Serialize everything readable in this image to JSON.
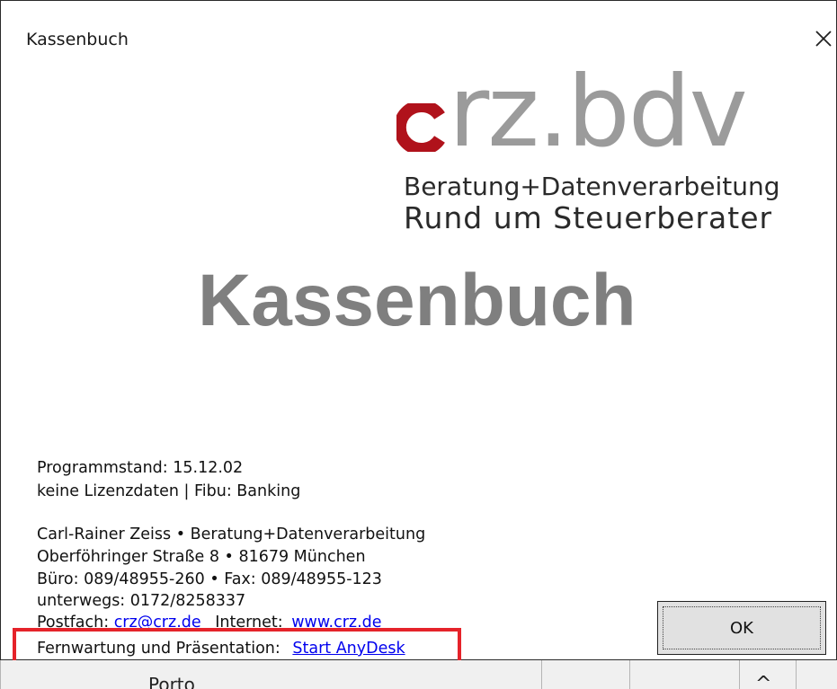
{
  "window": {
    "title": "Kassenbuch"
  },
  "logo": {
    "c_letter": "c",
    "rest": "rz.bdv",
    "line1": "Beratung+Datenverarbeitung",
    "line2": "Rund um Steuerberater",
    "accent_color": "#b0121b",
    "gray_color": "#9b9b9b"
  },
  "main": {
    "big_title": "Kassenbuch"
  },
  "info": {
    "programmstand": "Programmstand: 15.12.02",
    "lizenz": "keine Lizenzdaten | Fibu: Banking",
    "address_name_a": "Carl-Rainer Zeiss",
    "address_name_b": "Beratung+Datenverarbeitung",
    "street": "Oberföhringer Straße 8",
    "city": "81679 München",
    "buero": "Büro: 089/48955-260",
    "fax": "Fax: 089/48955-123",
    "unterwegs": "unterwegs: 0172/8258337",
    "postfach_label": "Postfach:",
    "postfach_email": "crz@crz.de",
    "internet_label": "Internet:",
    "internet_url": "www.crz.de",
    "fernwartung_label": "Fernwartung und Präsentation:",
    "anydesk_link": "Start AnyDesk",
    "bullet": "•"
  },
  "buttons": {
    "ok": "OK"
  },
  "background": {
    "column_label": "Porto",
    "caret": "^"
  },
  "colors": {
    "highlight": "#e5232a",
    "link": "#0000ee"
  }
}
